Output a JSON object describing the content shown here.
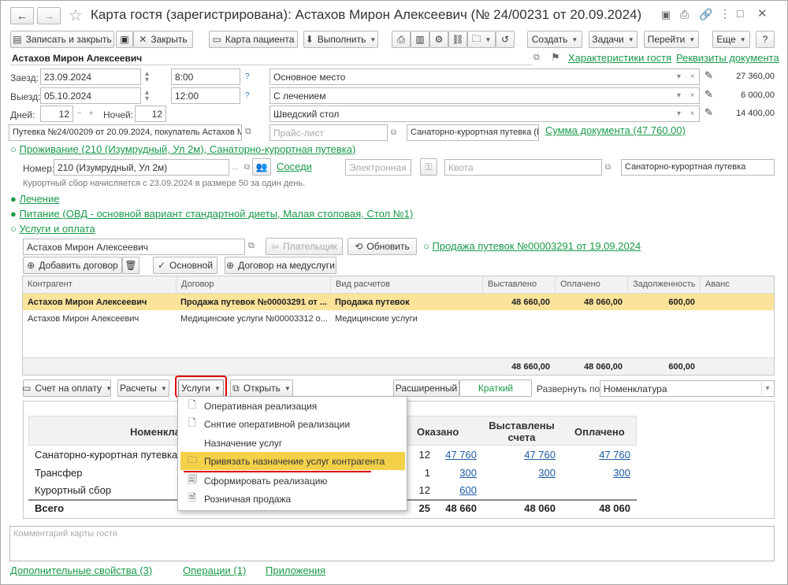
{
  "window": {
    "title": "Карта гостя (зарегистрирована): Астахов Мирон Алексеевич (№ 24/00231 от 20.09.2024)"
  },
  "toolbar": {
    "save_close": "Записать и закрыть",
    "close": "Закрыть",
    "patient_card": "Карта пациента",
    "execute": "Выполнить",
    "create": "Создать",
    "tasks": "Задачи",
    "goto": "Перейти",
    "more": "Еще",
    "help": "?"
  },
  "guest": {
    "name": "Астахов Мирон Алексеевич",
    "characteristics_link": "Характеристики гостя",
    "requisites_link": "Реквизиты документа"
  },
  "stay": {
    "arrival_label": "Заезд:",
    "arrival_date": "23.09.2024",
    "arrival_time": "8:00",
    "departure_label": "Выезд:",
    "departure_date": "05.10.2024",
    "departure_time": "12:00",
    "days_label": "Дней:",
    "days": "12",
    "nights_label": "Ночей:",
    "nights": "12",
    "q": "?"
  },
  "services_right": [
    {
      "name": "Основное место",
      "amount": "27 360,00"
    },
    {
      "name": "С лечением",
      "amount": "6 000,00"
    },
    {
      "name": "Шведский стол",
      "amount": "14 400,00"
    }
  ],
  "voucher": {
    "text": "Путевка №24/00209 от 20.09.2024, покупатель Астахов Мирон",
    "price_list_placeholder": "Прайс-лист",
    "type": "Санаторно-курортная путевка (Г",
    "sum_link": "Сумма документа (47 760.00)"
  },
  "accommodation": {
    "header": "Проживание (210 (Изумрудный, Ул 2м), Санаторно-курортная путевка)",
    "room_label": "Номер:",
    "room": "210 (Изумрудный, Ул 2м)",
    "neighbors_link": "Соседи",
    "electronic_placeholder": "Электронная ...",
    "quota_placeholder": "Квота",
    "tariff": "Санаторно-курортная путевка",
    "tax_note": "Курортный сбор начисляется с 23.09.2024 в размере 50  за один день."
  },
  "sections": {
    "treatment": "Лечение",
    "meals": "Питание (ОВД - основной вариант стандартной диеты, Малая столовая, Стол №1)",
    "services": "Услуги и оплата"
  },
  "payment": {
    "payer_name": "Астахов Мирон Алексеевич",
    "payer_button": "Плательщик",
    "refresh_button": "Обновить",
    "sale_link": "Продажа путевок №00003291 от 19.09.2024",
    "add_contract": "Добавить договор",
    "main_button": "Основной",
    "medical_contract": "Договор на медуслуги"
  },
  "contracts_table": {
    "columns": [
      "Контрагент",
      "Договор",
      "Вид расчетов",
      "Выставлено",
      "Оплачено",
      "Задолженность",
      "Аванс"
    ],
    "rows": [
      [
        "Астахов Мирон Алексеевич",
        "Продажа путевок №00003291 от ...",
        "Продажа путевок",
        "48 660,00",
        "48 060,00",
        "600,00",
        ""
      ],
      [
        "Астахов Мирон Алексеевич",
        "Медицинские услуги №00003312 о...",
        "Медицинские услуги",
        "",
        "",
        "",
        ""
      ]
    ],
    "totals": [
      "48 660,00",
      "48 060,00",
      "600,00"
    ]
  },
  "actions_bar": {
    "invoice": "Счет на оплату",
    "settlements": "Расчеты",
    "services": "Услуги",
    "open": "Открыть",
    "extended": "Расширенный",
    "short": "Краткий",
    "expand_label": "Развернуть по:",
    "expand_value": "Номенклатура"
  },
  "services_menu": [
    "Оперативная реализация",
    "Снятие оперативной реализации",
    "Назначение услуг",
    "Привязать назначение услуг контрагента",
    "Сформировать реализацию",
    "Розничная продажа"
  ],
  "summary_table": {
    "col_nomenclature": "Номенкла",
    "col_rendered": "Оказано",
    "col_invoiced": "Выставлены счета",
    "col_paid": "Оплачено",
    "rows": [
      {
        "name": "Санаторно-курортная путевка",
        "qty": "12",
        "rendered": "47 760",
        "invoiced": "47 760",
        "paid": "47 760"
      },
      {
        "name": "Трансфер",
        "qty": "1",
        "rendered": "300",
        "invoiced": "300",
        "paid": "300"
      },
      {
        "name": "Курортный сбор",
        "qty": "12",
        "rendered": "600",
        "invoiced": "",
        "paid": ""
      }
    ],
    "total": {
      "name": "Всего",
      "qty": "25",
      "rendered": "48 660",
      "invoiced": "48 060",
      "paid": "48 060"
    }
  },
  "comment_placeholder": "Комментарий карты гостя",
  "footer": {
    "additional": "Дополнительные свойства (3)",
    "operations": "Операции (1)",
    "attachments": "Приложения"
  },
  "colors": {
    "link_green": "#1a9a49",
    "highlight_yellow": "#fbe39a",
    "menu_highlight": "#f5d14a",
    "annotation_red": "#e00000"
  }
}
